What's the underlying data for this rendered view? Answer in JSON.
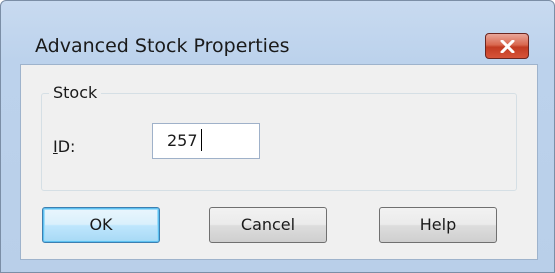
{
  "window": {
    "title": "Advanced Stock Properties"
  },
  "group": {
    "label": "Stock"
  },
  "fields": {
    "id_label_accel": "I",
    "id_label_rest": "D:",
    "id_value": "257"
  },
  "buttons": {
    "ok": "OK",
    "cancel": "Cancel",
    "help": "Help"
  },
  "colors": {
    "titlebar": "#bcd2ec",
    "close_button": "#c23b22",
    "dialog_background": "#f0f0f0",
    "default_button_border": "#3c7fb1"
  }
}
